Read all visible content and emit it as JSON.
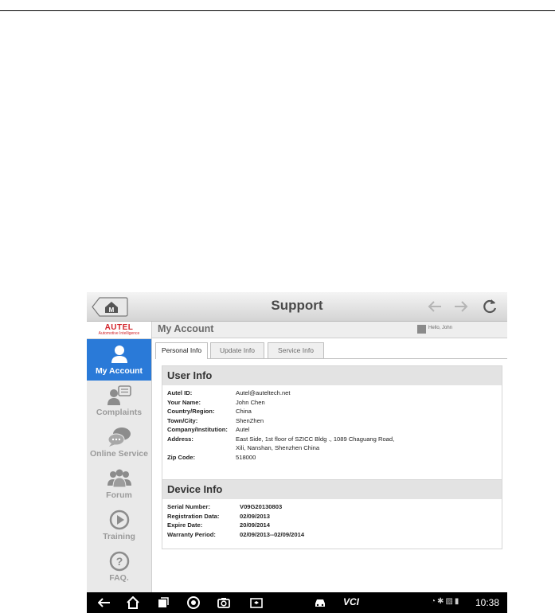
{
  "app": {
    "title": "Support"
  },
  "brand": {
    "name": "AUTEL",
    "tagline": "Automotive Intelligence"
  },
  "sidebar": {
    "items": [
      {
        "label": "My Account",
        "active": true
      },
      {
        "label": "Complaints"
      },
      {
        "label": "Online Service"
      },
      {
        "label": "Forum"
      },
      {
        "label": "Training"
      },
      {
        "label": "FAQ."
      }
    ]
  },
  "account": {
    "title": "My Account",
    "greeting": "Hello, John"
  },
  "tabs": [
    {
      "label": "Personal Info",
      "active": true
    },
    {
      "label": "Update Info"
    },
    {
      "label": "Service Info"
    }
  ],
  "user_info": {
    "heading": "User Info",
    "rows": [
      {
        "key": "Autel ID:",
        "value": "Autel@auteltech.net"
      },
      {
        "key": "Your Name:",
        "value": "John Chen"
      },
      {
        "key": "Country/Region:",
        "value": "China"
      },
      {
        "key": "Town/City:",
        "value": "ShenZhen"
      },
      {
        "key": "Company/Institution:",
        "value": "Autel"
      },
      {
        "key": "Address:",
        "value": "East Side, 1st floor of SZICC Bldg ., 1089 Chaguang Road,"
      },
      {
        "key": "",
        "value": "Xili, Nanshan, Shenzhen China"
      },
      {
        "key": "Zip Code:",
        "value": "518000"
      }
    ]
  },
  "device_info": {
    "heading": "Device Info",
    "rows": [
      {
        "key": "Serial Number:",
        "value": "V09G20130803"
      },
      {
        "key": "Registration Data:",
        "value": "02/09/2013"
      },
      {
        "key": "Expire Date:",
        "value": "20/09/2014"
      },
      {
        "key": "Warranty Period:",
        "value": "02/09/2013--02/09/2014"
      }
    ]
  },
  "statusbar": {
    "vci_label": "VCI",
    "time": "10:38"
  },
  "colors": {
    "accent": "#2a7ad8",
    "brand_red": "#d2232a"
  }
}
